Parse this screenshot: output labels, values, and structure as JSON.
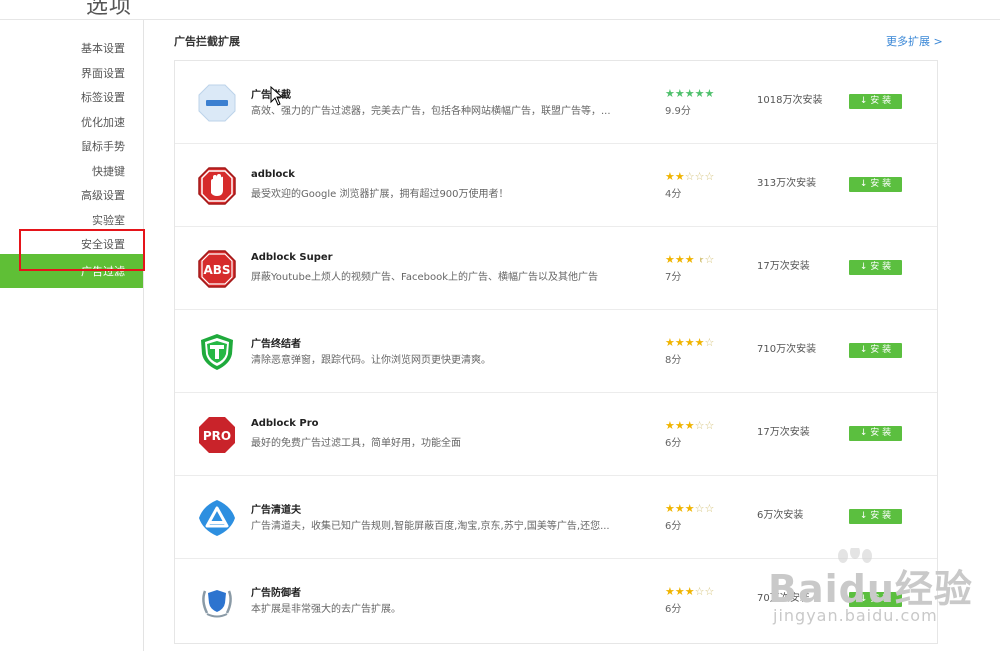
{
  "page": {
    "title": "选项"
  },
  "sidebar": {
    "items": [
      {
        "label": "基本设置"
      },
      {
        "label": "界面设置"
      },
      {
        "label": "标签设置"
      },
      {
        "label": "优化加速"
      },
      {
        "label": "鼠标手势"
      },
      {
        "label": "快捷键"
      },
      {
        "label": "高级设置"
      },
      {
        "label": "实验室"
      },
      {
        "label": "安全设置"
      },
      {
        "label": "广告过滤"
      }
    ],
    "active": "广告过滤"
  },
  "main": {
    "section_title": "广告拦截扩展",
    "more_label": "更多扩展 >",
    "install_label": "安 装",
    "extensions": [
      {
        "name": "广告拦截",
        "desc": "高效、强力的广告过滤器，完美去广告，包括各种网站横幅广告，联盟广告等，...",
        "rating": 5,
        "score": "9.9分",
        "installs": "1018万次安装",
        "icon": "ad-block-minus-icon"
      },
      {
        "name": "adblock",
        "desc": "最受欢迎的Google 浏览器扩展，拥有超过900万使用者！",
        "rating": 2,
        "score": "4分",
        "installs": "313万次安装",
        "icon": "stop-hand-icon"
      },
      {
        "name": "Adblock Super",
        "desc": "屏蔽Youtube上烦人的视频广告、Facebook上的广告、横幅广告以及其他广告",
        "rating": 3.5,
        "score": "7分",
        "installs": "17万次安装",
        "icon": "abs-stop-icon"
      },
      {
        "name": "广告终结者",
        "desc": "清除恶意弹窗，跟踪代码。让你浏览网页更快更清爽。",
        "rating": 4,
        "score": "8分",
        "installs": "710万次安装",
        "icon": "t-shield-icon"
      },
      {
        "name": "Adblock Pro",
        "desc": "最好的免费广告过滤工具，简单好用，功能全面",
        "rating": 3,
        "score": "6分",
        "installs": "17万次安装",
        "icon": "pro-stop-icon"
      },
      {
        "name": "广告清道夫",
        "desc": "广告清道夫，收集已知广告规则,智能屏蔽百度,淘宝,京东,苏宁,国美等广告,还您...",
        "rating": 3,
        "score": "6分",
        "installs": "6万次安装",
        "icon": "triangle-cleaner-icon"
      },
      {
        "name": "广告防御者",
        "desc": "本扩展是非常强大的去广告扩展。",
        "rating": 3,
        "score": "6分",
        "installs": "70万次安装",
        "icon": "laurel-shield-icon"
      }
    ]
  },
  "colors": {
    "accent_green": "#5fbf36",
    "highlight_red": "#e5141a",
    "star_gold": "#f0b400",
    "star_green": "#4fc06c",
    "link_blue": "#3a87d6"
  },
  "watermark": {
    "text": "Baidu经验",
    "sub": "jingyan.baidu.com"
  }
}
